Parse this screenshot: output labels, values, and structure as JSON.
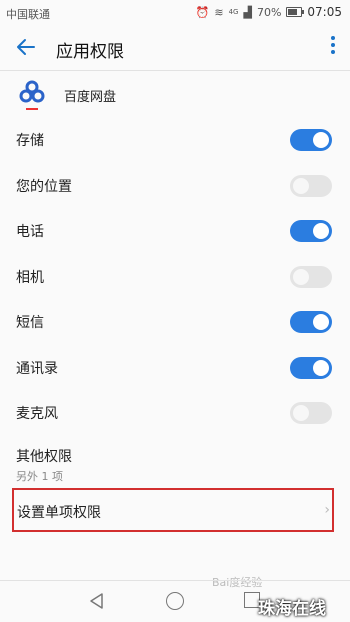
{
  "status_bar": {
    "carrier": "中国联通",
    "network": "4G",
    "battery": "70%",
    "time": "07:05"
  },
  "app_bar": {
    "title": "应用权限"
  },
  "app": {
    "name": "百度网盘"
  },
  "permissions": [
    {
      "label": "存储",
      "enabled": true
    },
    {
      "label": "您的位置",
      "enabled": false
    },
    {
      "label": "电话",
      "enabled": true
    },
    {
      "label": "相机",
      "enabled": false
    },
    {
      "label": "短信",
      "enabled": true
    },
    {
      "label": "通讯录",
      "enabled": true
    },
    {
      "label": "麦克风",
      "enabled": false
    }
  ],
  "other_permissions": {
    "title": "其他权限",
    "subtitle": "另外 1 项"
  },
  "single_permission": {
    "label": "设置单项权限"
  },
  "watermarks": {
    "baidu": "Bai度经验",
    "site": "珠海在线"
  }
}
